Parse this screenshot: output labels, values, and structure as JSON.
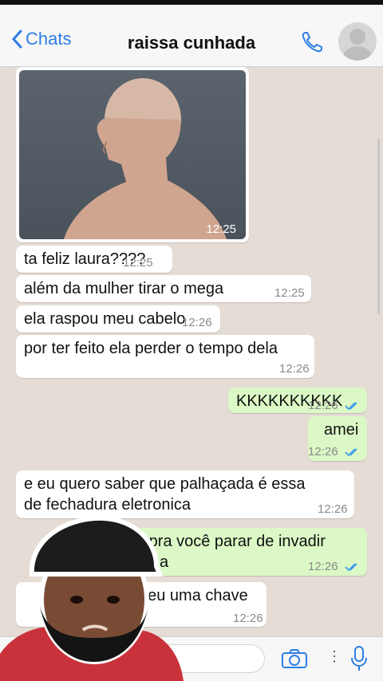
{
  "header": {
    "back_label": "Chats",
    "contact_name": "raissa cunhada"
  },
  "messages": [
    {
      "text": "ta feliz laura????",
      "time": "12:25"
    },
    {
      "text": "além da mulher tirar o mega",
      "time": "12:25"
    },
    {
      "text": "ela raspou meu cabelo",
      "time": "12:26"
    },
    {
      "text": "por ter feito ela perder o tempo dela",
      "time": "12:26"
    },
    {
      "text": "KKKKKKKKKK",
      "time": "12:26"
    },
    {
      "text": "amei",
      "time": "12:26"
    },
    {
      "text": "e eu quero saber que palhaçada é essa",
      "text2": "de fechadura eletronica",
      "time": "12:26"
    },
    {
      "text": "im pra você parar de invadir",
      "text2": "a",
      "time": "12:26"
    },
    {
      "text": "deu uma chave",
      "time": "12:26"
    }
  ],
  "photo": {
    "time": "12:25"
  },
  "icons": {
    "back": "chevron-left-icon",
    "call": "phone-icon",
    "avatar": "person-icon",
    "camera": "camera-icon",
    "mic": "microphone-icon",
    "read": "double-check-icon"
  },
  "colors": {
    "accent": "#2d7ee6",
    "incoming": "#ffffff",
    "outgoing": "#dcf8c6",
    "background": "#e5ddd5"
  }
}
